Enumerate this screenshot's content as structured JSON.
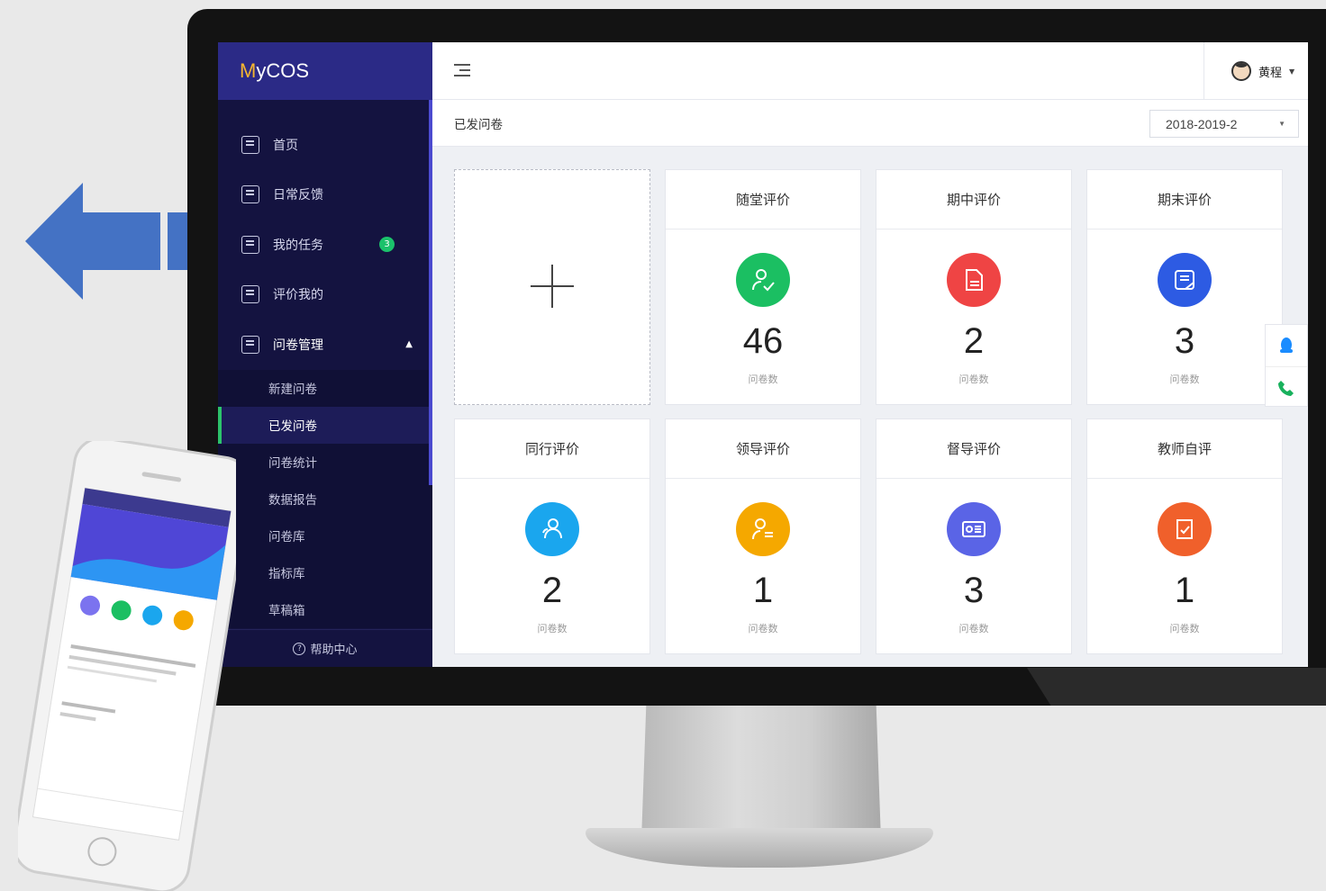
{
  "app": {
    "logo_prefix": "M",
    "logo_rest": "yCOS"
  },
  "sidebar": {
    "items": [
      {
        "label": "首页",
        "icon": "layout-icon"
      },
      {
        "label": "日常反馈",
        "icon": "feedback-icon"
      },
      {
        "label": "我的任务",
        "icon": "task-icon",
        "badge": "3"
      },
      {
        "label": "评价我的",
        "icon": "evaluation-icon"
      },
      {
        "label": "问卷管理",
        "icon": "survey-icon",
        "expanded": true
      }
    ],
    "subitems": [
      {
        "label": "新建问卷"
      },
      {
        "label": "已发问卷",
        "active": true
      },
      {
        "label": "问卷统计"
      },
      {
        "label": "数据报告"
      },
      {
        "label": "问卷库"
      },
      {
        "label": "指标库"
      },
      {
        "label": "草稿箱"
      }
    ],
    "help": "帮助中心"
  },
  "header": {
    "user_name": "黄程"
  },
  "subbar": {
    "title": "已发问卷",
    "term_value": "2018-2019-2"
  },
  "cards": [
    {
      "title": "随堂评价",
      "count": "46",
      "unit": "问卷数",
      "color": "#1bbf62",
      "icon": "person-check-icon"
    },
    {
      "title": "期中评价",
      "count": "2",
      "unit": "问卷数",
      "color": "#ef4444",
      "icon": "document-icon"
    },
    {
      "title": "期末评价",
      "count": "3",
      "unit": "问卷数",
      "color": "#2d5be3",
      "icon": "notepad-icon"
    },
    {
      "title": "同行评价",
      "count": "2",
      "unit": "问卷数",
      "color": "#1aa6ee",
      "icon": "peers-icon"
    },
    {
      "title": "领导评价",
      "count": "1",
      "unit": "问卷数",
      "color": "#f5a800",
      "icon": "leader-icon"
    },
    {
      "title": "督导评价",
      "count": "3",
      "unit": "问卷数",
      "color": "#5a64e6",
      "icon": "id-card-icon"
    },
    {
      "title": "教师自评",
      "count": "1",
      "unit": "问卷数",
      "color": "#f0602b",
      "icon": "self-check-icon"
    }
  ],
  "colors": {
    "sidebar_bg": "#141340",
    "logo_bg": "#2b2a86",
    "accent_green": "#2cc36b",
    "arrow_blue": "#4472c4"
  }
}
